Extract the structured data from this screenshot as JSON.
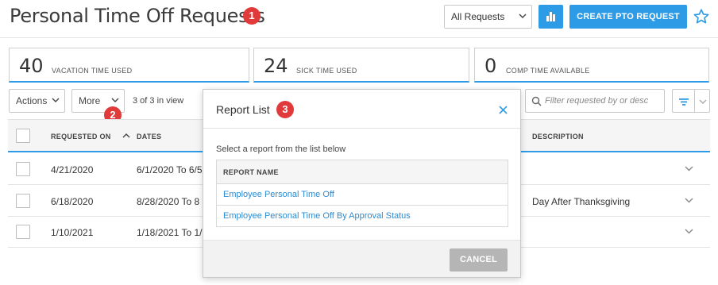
{
  "header": {
    "title": "Personal Time Off Requests",
    "badge": "1",
    "filter_select": {
      "value": "All Requests"
    },
    "chart_icon": "bar-chart-icon",
    "create_label": "CREATE PTO REQUEST",
    "favorite_icon": "star-outline-icon"
  },
  "stats": [
    {
      "value": "40",
      "label": "VACATION TIME USED"
    },
    {
      "value": "24",
      "label": "SICK TIME USED"
    },
    {
      "value": "0",
      "label": "COMP TIME AVAILABLE"
    }
  ],
  "toolbar": {
    "actions_label": "Actions",
    "more_label": "More",
    "more_badge": "2",
    "count_text": "3 of 3 in view",
    "filter_placeholder": "Filter requested by or desc"
  },
  "table": {
    "columns": {
      "requested_on": "REQUESTED ON",
      "dates": "DATES",
      "description": "DESCRIPTION"
    },
    "rows": [
      {
        "requested_on": "4/21/2020",
        "dates": "6/1/2020 To 6/5",
        "description": ""
      },
      {
        "requested_on": "6/18/2020",
        "dates": "8/28/2020 To 8",
        "description": "Day After Thanksgiving"
      },
      {
        "requested_on": "1/10/2021",
        "dates": "1/18/2021 To 1/",
        "description": ""
      }
    ]
  },
  "modal": {
    "title": "Report List",
    "badge": "3",
    "instruction": "Select a report from the list below",
    "column_header": "REPORT NAME",
    "reports": [
      "Employee Personal Time Off",
      "Employee Personal Time Off By Approval Status"
    ],
    "cancel_label": "CANCEL"
  },
  "colors": {
    "accent": "#2d9be5",
    "badge": "#e03a3a",
    "link": "#2d8bd0"
  }
}
